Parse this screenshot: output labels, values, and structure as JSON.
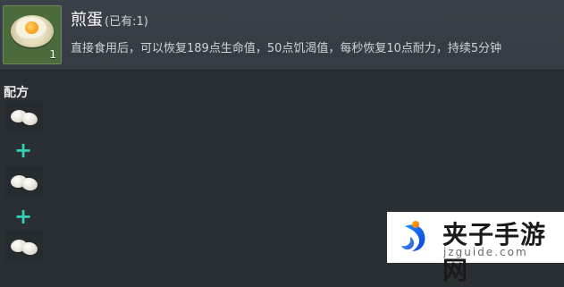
{
  "item": {
    "name": "煎蛋",
    "owned": "(已有:1)",
    "count": "1",
    "description": "直接食用后，可以恢复189点生命值，50点饥渴值，每秒恢复10点耐力，持续5分钟",
    "icon": "fried-egg-icon"
  },
  "recipe": {
    "label": "配方",
    "plus_symbol": "+",
    "ingredients": [
      {
        "icon": "egg-icon"
      },
      {
        "icon": "egg-icon"
      },
      {
        "icon": "egg-icon"
      }
    ]
  },
  "watermark": {
    "name": "夹子手游网",
    "domain": "jzguide.com"
  },
  "colors": {
    "background": "#2a2f33",
    "card": "#3b4148",
    "slot": "#4c6b3d",
    "plus": "#33d0b3"
  }
}
